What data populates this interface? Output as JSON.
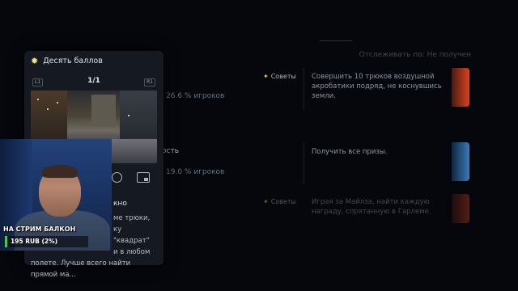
{
  "filter_text": "Отслеживать по: Не получен",
  "rows": [
    {
      "title": "",
      "percent": "26.6 % игроков",
      "tips_label": "Советы",
      "description": "Совершить 10 трюков воздушной акробатики подряд, не коснувшись земли.",
      "thumb_color": "#d9431f"
    },
    {
      "title": "ость",
      "percent": "19.0 % игроков",
      "tips_label": "",
      "description": "Получить все призы.",
      "thumb_color": "#3a7ab8"
    },
    {
      "title": "",
      "percent": "",
      "tips_label": "Советы",
      "description": "Играя за Майлза, найти каждую награду, спрятанную в Гарлеме.",
      "thumb_color": "#b23a2a"
    }
  ],
  "panel": {
    "title": "Десять баллов",
    "l1": "L1",
    "r1": "R1",
    "pager": "1/1",
    "tip_title": "кно",
    "tip_lines": [
      "ме трюки,",
      "ку \"квадрат\"",
      "и в любом",
      "полете. Лучше всего найти прямой ма..."
    ],
    "icons": [
      "rewind-10-icon",
      "picture-in-picture-icon"
    ]
  },
  "stream": {
    "caption": "НА СТРИМ БАЛКОН",
    "donation": "195 RUB (2%)"
  }
}
